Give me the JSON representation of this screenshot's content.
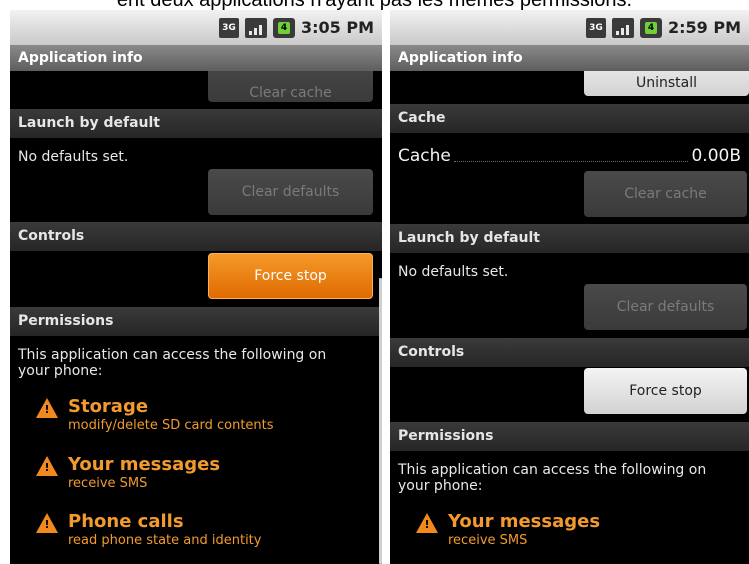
{
  "caption": "ent deux applications n'ayant pas les mêmes permissions.",
  "left": {
    "status": {
      "network": "3G",
      "battery_mark": "4",
      "time": "3:05 PM"
    },
    "title": "Application info",
    "clear_cache_label": "Clear cache",
    "launch_header": "Launch by default",
    "no_defaults": "No defaults set.",
    "clear_defaults_label": "Clear defaults",
    "controls_header": "Controls",
    "force_stop_label": "Force stop",
    "permissions_header": "Permissions",
    "permissions_intro": "This application can access the following on your phone:",
    "permissions": [
      {
        "title": "Storage",
        "detail": "modify/delete SD card contents"
      },
      {
        "title": "Your messages",
        "detail": "receive SMS"
      },
      {
        "title": "Phone calls",
        "detail": "read phone state and identity"
      }
    ]
  },
  "right": {
    "status": {
      "network": "3G",
      "battery_mark": "4",
      "time": "2:59 PM"
    },
    "title": "Application info",
    "uninstall_label": "Uninstall",
    "cache_header": "Cache",
    "cache_label": "Cache",
    "cache_value": "0.00B",
    "clear_cache_label": "Clear cache",
    "launch_header": "Launch by default",
    "no_defaults": "No defaults set.",
    "clear_defaults_label": "Clear defaults",
    "controls_header": "Controls",
    "force_stop_label": "Force stop",
    "permissions_header": "Permissions",
    "permissions_intro": "This application can access the following on your phone:",
    "permissions": [
      {
        "title": "Your messages",
        "detail": "receive SMS"
      }
    ]
  },
  "colors": {
    "accent_orange": "#f08a1e",
    "button_orange": "#e06a00"
  }
}
